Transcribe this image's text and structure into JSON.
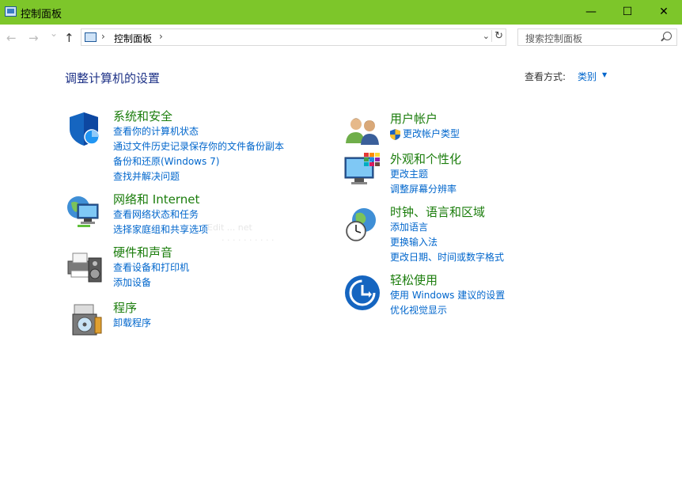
{
  "window": {
    "title": "控制面板",
    "minimize": "—",
    "maximize": "☐",
    "close": "✕"
  },
  "nav": {
    "back": "←",
    "forward": "→",
    "recent": "⌄",
    "up": "↑",
    "sep": "›",
    "crumb": "控制面板",
    "dropdown": "⌄",
    "refresh": "↻"
  },
  "search": {
    "placeholder": "搜索控制面板"
  },
  "main": {
    "heading": "调整计算机的设置",
    "view_by_label": "查看方式:",
    "view_by_value": "类别"
  },
  "left_categories": [
    {
      "title": "系统和安全",
      "links": [
        "查看你的计算机状态",
        "通过文件历史记录保存你的文件备份副本",
        "备份和还原(Windows 7)",
        "查找并解决问题"
      ]
    },
    {
      "title": "网络和 Internet",
      "links": [
        "查看网络状态和任务",
        "选择家庭组和共享选项"
      ]
    },
    {
      "title": "硬件和声音",
      "links": [
        "查看设备和打印机",
        "添加设备"
      ]
    },
    {
      "title": "程序",
      "links": [
        "卸载程序"
      ]
    }
  ],
  "right_categories": [
    {
      "title": "用户帐户",
      "links": [
        "更改帐户类型"
      ]
    },
    {
      "title": "外观和个性化",
      "links": [
        "更改主题",
        "调整屏幕分辨率"
      ]
    },
    {
      "title": "时钟、语言和区域",
      "links": [
        "添加语言",
        "更换输入法",
        "更改日期、时间或数字格式"
      ]
    },
    {
      "title": "轻松使用",
      "links": [
        "使用 Windows 建议的设置",
        "优化视觉显示"
      ]
    }
  ]
}
